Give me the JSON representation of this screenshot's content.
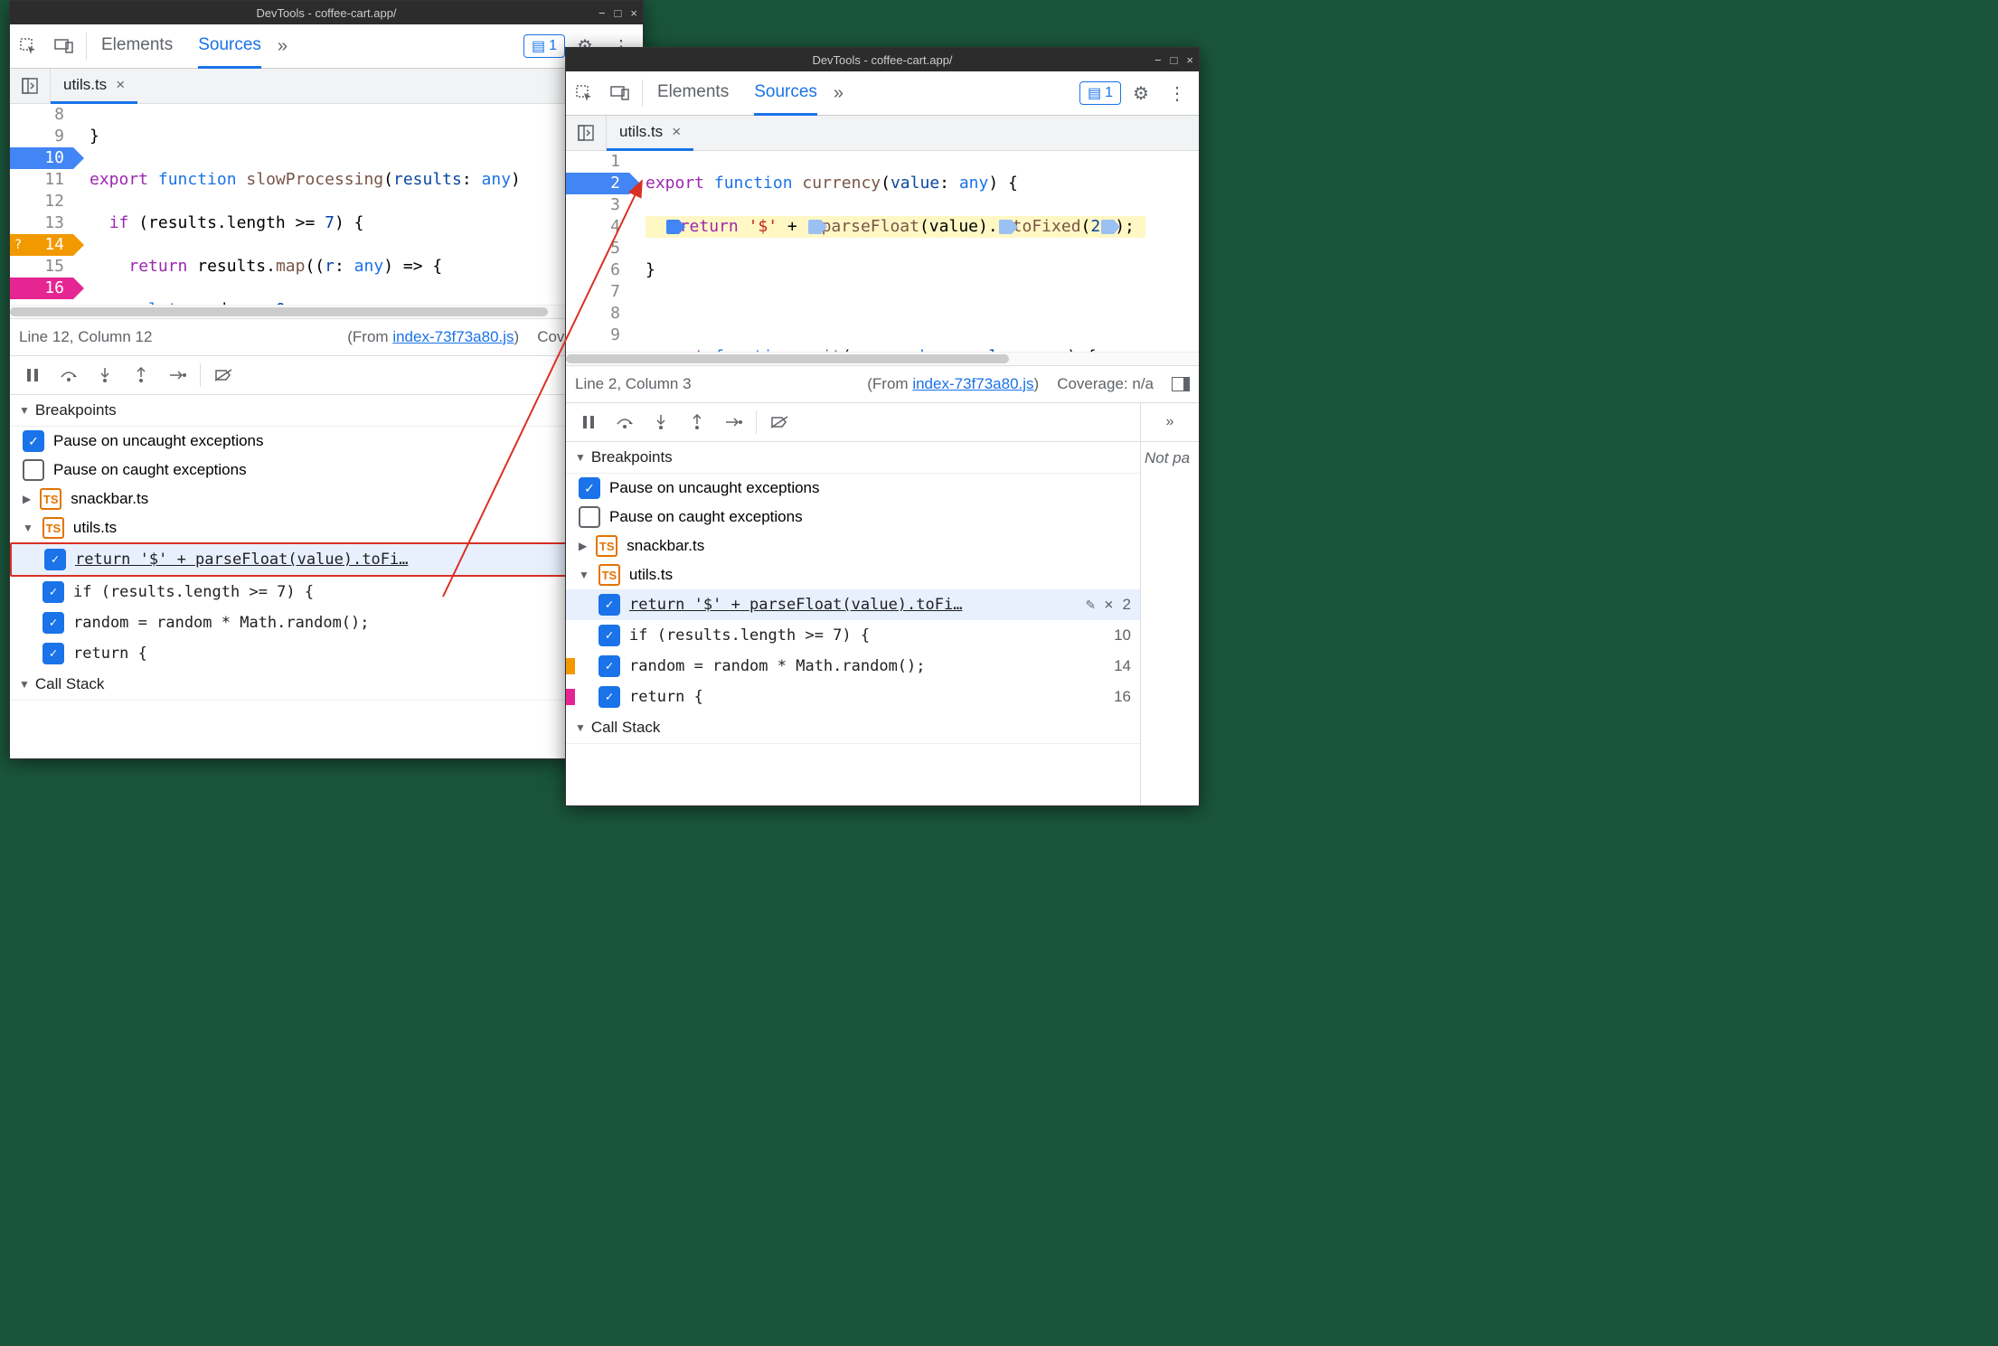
{
  "windowTitle": "DevTools - coffee-cart.app/",
  "toolbar": {
    "elementsTab": "Elements",
    "sourcesTab": "Sources",
    "issueCount": "1"
  },
  "fileTab": "utils.ts",
  "win1": {
    "code": {
      "startLine": 8,
      "lines": [
        {
          "n": 8,
          "bp": ""
        },
        {
          "n": 9,
          "bp": ""
        },
        {
          "n": 10,
          "bp": "blue"
        },
        {
          "n": 11,
          "bp": ""
        },
        {
          "n": 12,
          "bp": ""
        },
        {
          "n": 13,
          "bp": ""
        },
        {
          "n": 14,
          "bp": "orange"
        },
        {
          "n": 15,
          "bp": ""
        },
        {
          "n": 16,
          "bp": "pink"
        }
      ]
    },
    "status": {
      "pos": "Line 12, Column 12",
      "fromLabel": "(From ",
      "fromLink": "index-73f73a80.js",
      "fromClose": ")",
      "coverage": "Coverage: n/a"
    }
  },
  "win2": {
    "code": {
      "lines": [
        {
          "n": 1,
          "bp": ""
        },
        {
          "n": 2,
          "bp": "blue"
        },
        {
          "n": 3,
          "bp": ""
        },
        {
          "n": 4,
          "bp": ""
        },
        {
          "n": 5,
          "bp": ""
        },
        {
          "n": 6,
          "bp": ""
        },
        {
          "n": 7,
          "bp": ""
        },
        {
          "n": 8,
          "bp": ""
        },
        {
          "n": 9,
          "bp": ""
        }
      ]
    },
    "status": {
      "pos": "Line 2, Column 3",
      "fromLabel": "(From ",
      "fromLink": "index-73f73a80.js",
      "fromClose": ")",
      "coverage": "Coverage: n/a"
    },
    "rightPane": "Not pa"
  },
  "breakpoints": {
    "header": "Breakpoints",
    "pauseUncaught": "Pause on uncaught exceptions",
    "pauseCaught": "Pause on caught exceptions",
    "file1": "snackbar.ts",
    "file2": "utils.ts",
    "items": [
      {
        "text": "return '$' + parseFloat(value).toFi…",
        "num": "2"
      },
      {
        "text": "if (results.length >= 7) {",
        "num": "10"
      },
      {
        "text": "random = random * Math.random();",
        "num": "14"
      },
      {
        "text": "return {",
        "num": "16"
      }
    ],
    "items2": [
      {
        "text": "return '$' + parseFloat(value).toFi…",
        "num": "2"
      },
      {
        "text": "if (results.length >= 7) {",
        "num": "10"
      },
      {
        "text": "random = random * Math.random();",
        "num": "14"
      },
      {
        "text": "return {",
        "num": "16"
      }
    ]
  },
  "callStack": "Call Stack"
}
